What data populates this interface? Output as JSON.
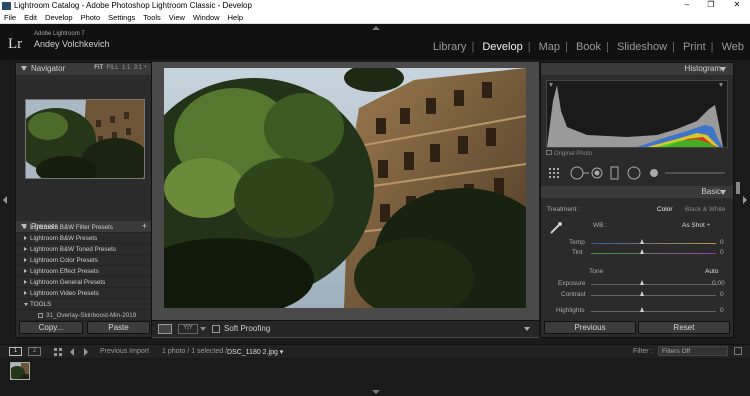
{
  "window": {
    "title": "Lightroom Catalog - Adobe Photoshop Lightroom Classic - Develop",
    "min": "–",
    "max": "❐",
    "close": "✕"
  },
  "menu": [
    "File",
    "Edit",
    "Develop",
    "Photo",
    "Settings",
    "Tools",
    "View",
    "Window",
    "Help"
  ],
  "identity": {
    "logo": "Lr",
    "product": "Adobe Lightroom 7",
    "user": "Andey Volchkevich"
  },
  "modules": [
    "Library",
    "Develop",
    "Map",
    "Book",
    "Slideshow",
    "Print",
    "Web"
  ],
  "active_module": "Develop",
  "navigator": {
    "title": "Navigator",
    "fit": "FIT",
    "fill": "FILL",
    "one": "1:1",
    "ratio": "3:1 ÷"
  },
  "presets": {
    "title": "Presets",
    "add": "+",
    "items": [
      "Lightroom B&W Filter Presets",
      "Lightroom B&W Presets",
      "Lightroom B&W Toned Presets",
      "Lightroom Color Presets",
      "Lightroom Effect Presets",
      "Lightroom General Presets",
      "Lightroom Video Presets",
      "TOOLS"
    ],
    "sub_item": "31_Overlay-Skinboost-Min-2019"
  },
  "left_buttons": {
    "copy": "Copy...",
    "paste": "Paste"
  },
  "toolbar": {
    "yy": "Y|Y",
    "soft_proofing": "Soft Proofing"
  },
  "histogram": {
    "title": "Histogram",
    "original_photo": "Original Photo"
  },
  "basic": {
    "title": "Basic",
    "treatment_label": "Treatment :",
    "color": "Color",
    "bw": "Black & White",
    "wb_label": "WB :",
    "wb_value": "As Shot ÷",
    "temp_label": "Temp",
    "temp_value": "0",
    "tint_label": "Tint",
    "tint_value": "0",
    "tone_label": "Tone",
    "auto": "Auto",
    "exposure_label": "Exposure",
    "exposure_value": "0,00",
    "contrast_label": "Contrast",
    "contrast_value": "0",
    "highlights_label": "Highlights",
    "highlights_value": "0"
  },
  "right_buttons": {
    "previous": "Previous",
    "reset": "Reset"
  },
  "filmstrip": {
    "view1": "1",
    "view2": "2",
    "source": "Previous Import",
    "count": "1 photo / 1 selected /",
    "filename": "DSC_1180 2.jpg ▾",
    "filter_label": "Filter :",
    "filter_value": "Filters Off"
  },
  "colors": {
    "accent": "#f0f0f0",
    "panel": "#2b2b2b",
    "canvas": "#4a4a4a"
  }
}
